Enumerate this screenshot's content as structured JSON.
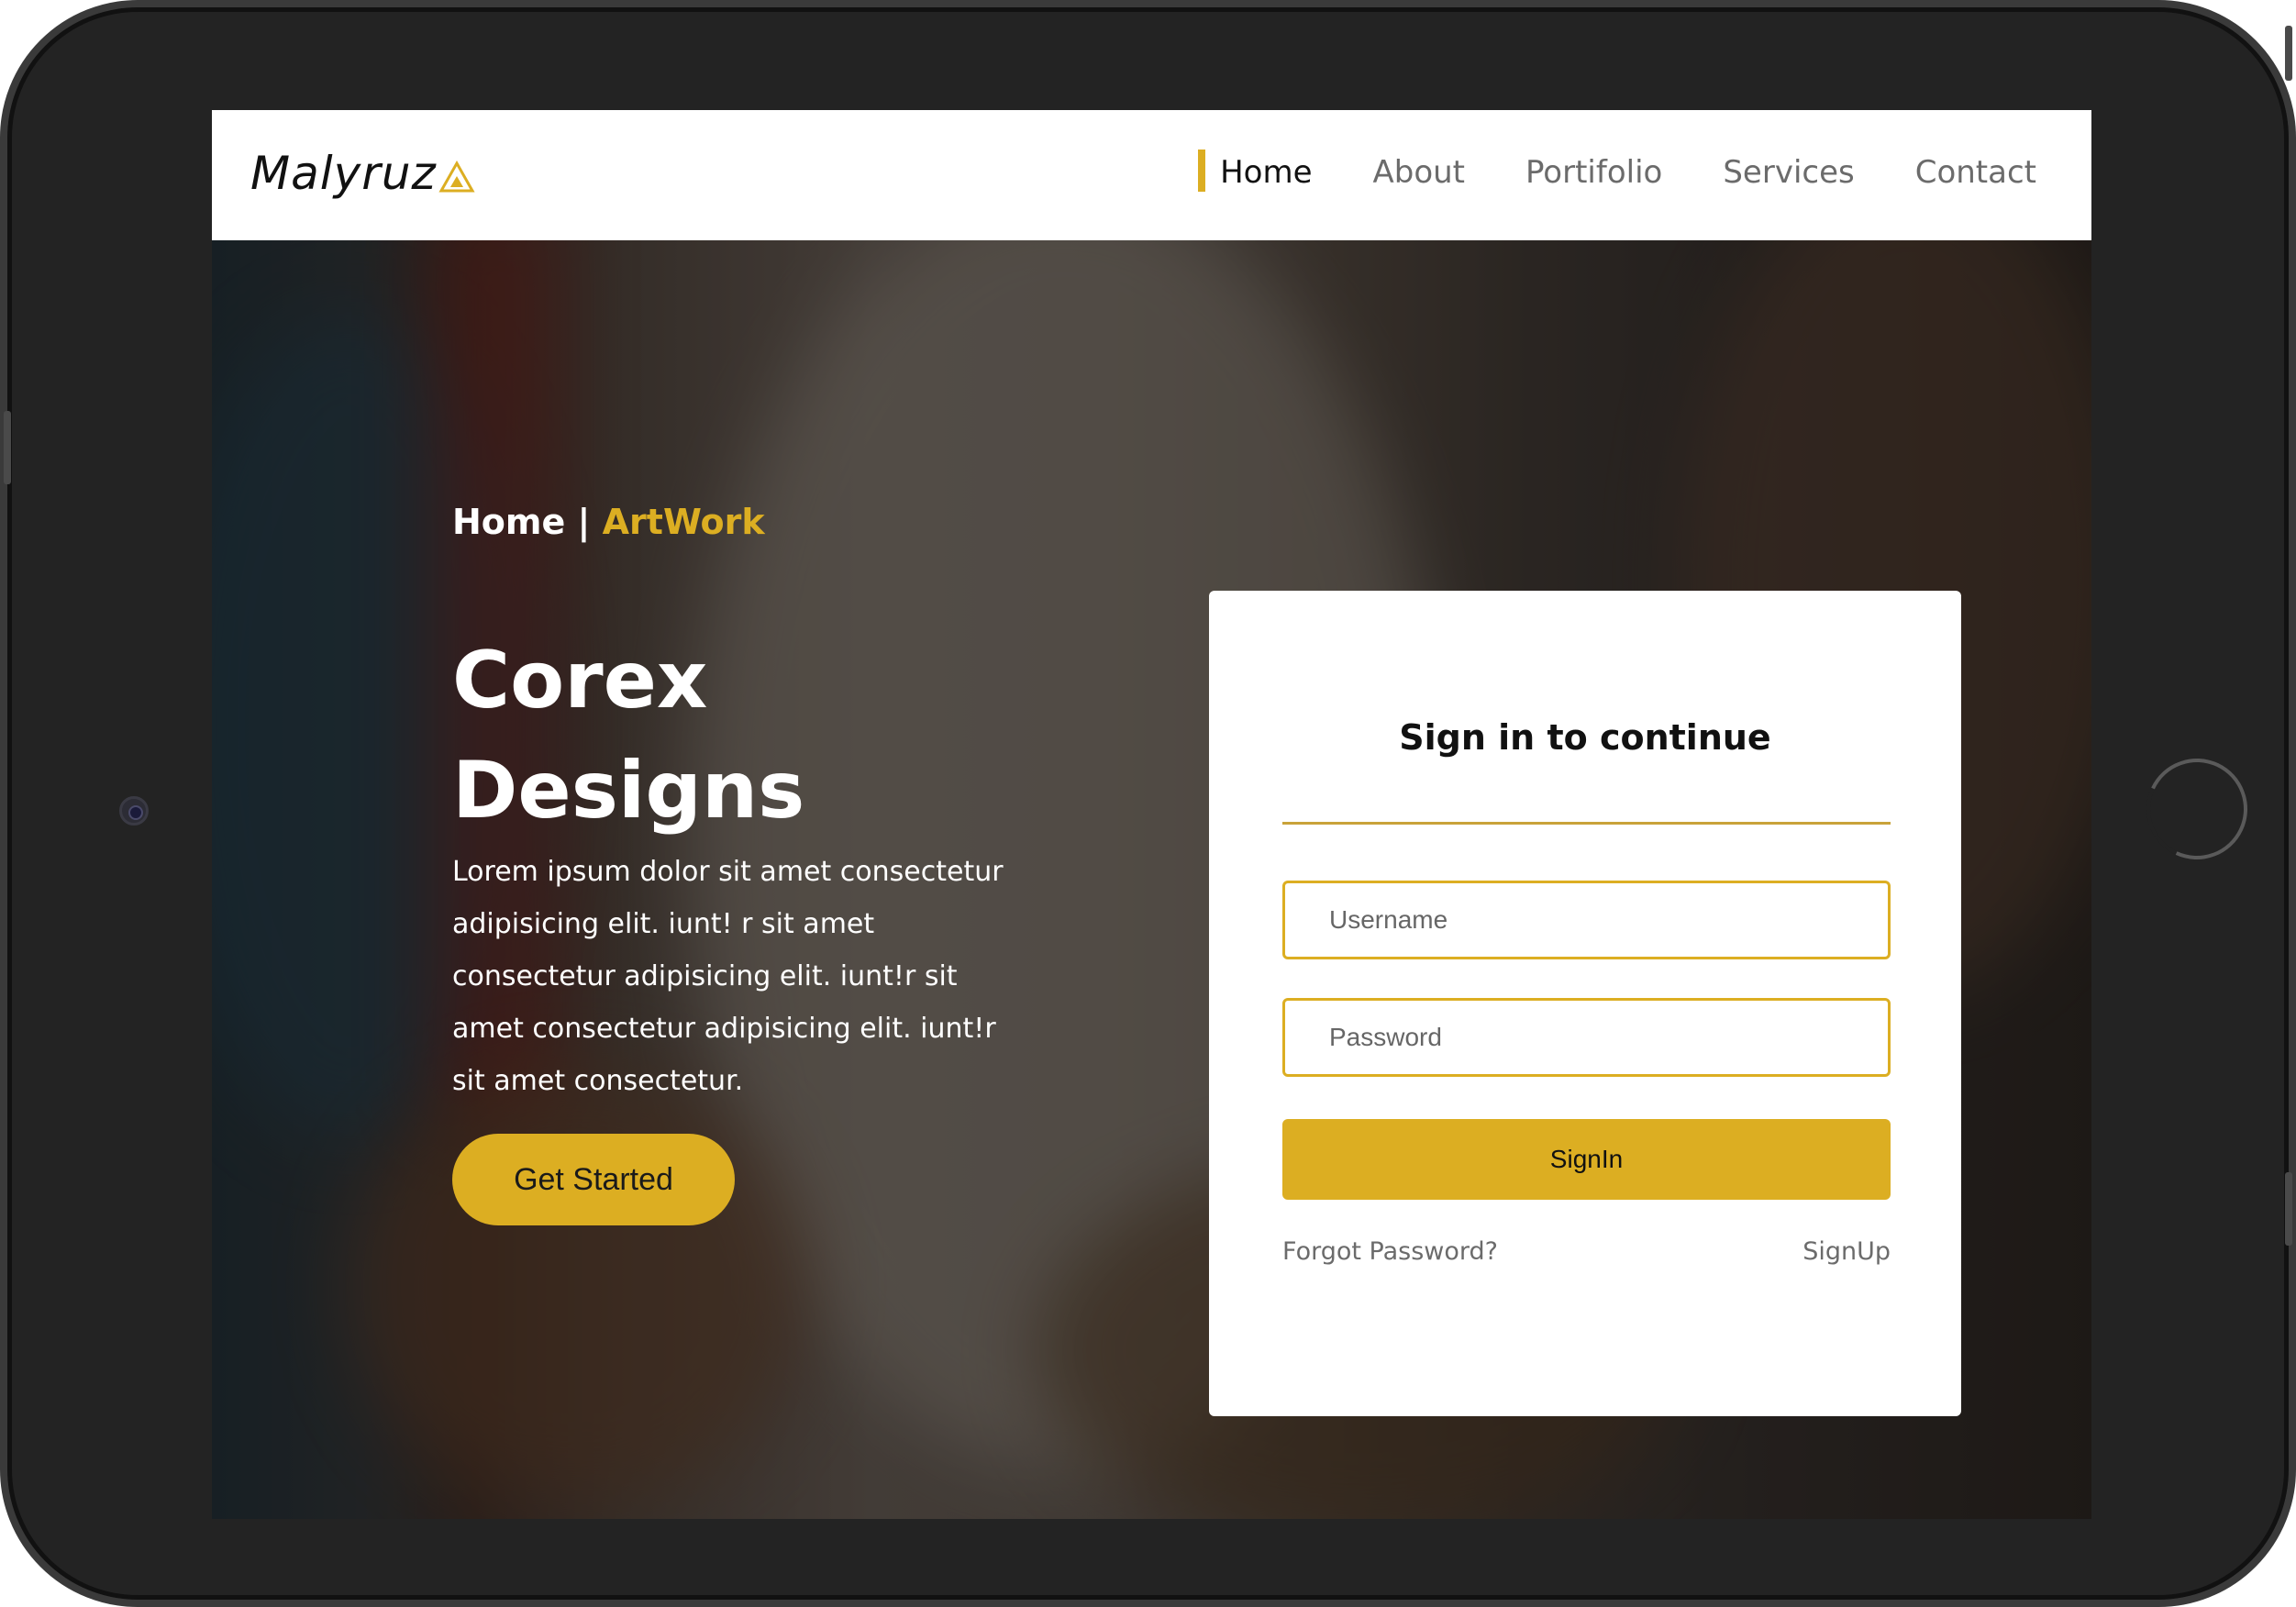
{
  "header": {
    "logo_text": "Malyruz",
    "nav": [
      {
        "label": "Home",
        "active": true
      },
      {
        "label": "About",
        "active": false
      },
      {
        "label": "Portifolio",
        "active": false
      },
      {
        "label": "Services",
        "active": false
      },
      {
        "label": "Contact",
        "active": false
      }
    ]
  },
  "hero": {
    "breadcrumb_home": "Home",
    "breadcrumb_sep": " | ",
    "breadcrumb_current": "ArtWork",
    "title_line1": "Corex",
    "title_line2": "Designs",
    "description": "Lorem ipsum dolor sit amet consectetur adipisicing elit. iunt! r sit amet consectetur adipisicing elit. iunt!r sit amet consectetur adipisicing elit. iunt!r sit amet consectetur.",
    "cta_label": "Get Started"
  },
  "signin": {
    "title": "Sign in to continue",
    "username_placeholder": "Username",
    "password_placeholder": "Password",
    "submit_label": "SignIn",
    "forgot_label": "Forgot Password?",
    "signup_label": "SignUp"
  },
  "colors": {
    "accent": "#dcae22",
    "frame": "#232323",
    "header_bg": "#ffffff"
  },
  "icons": {
    "logo": "triangle-logo-icon"
  }
}
